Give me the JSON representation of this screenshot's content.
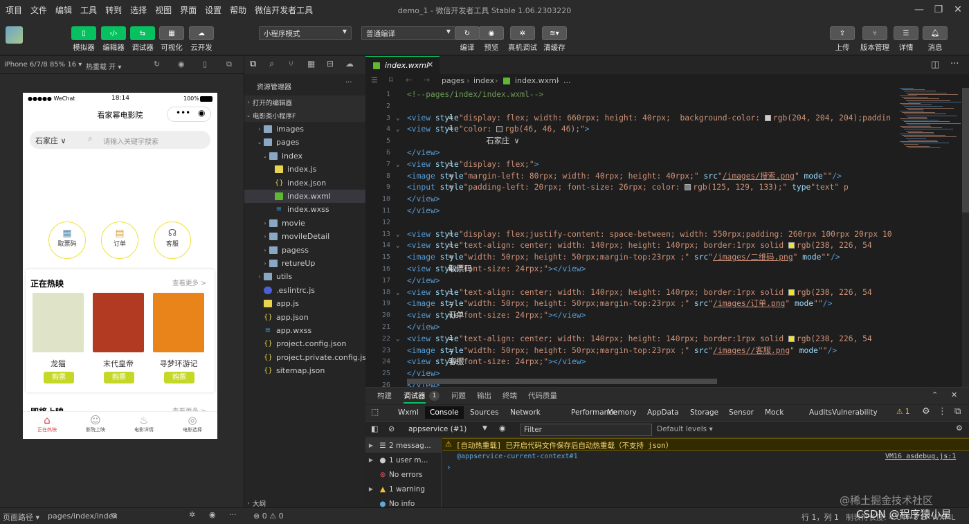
{
  "menu": [
    "项目",
    "文件",
    "编辑",
    "工具",
    "转到",
    "选择",
    "视图",
    "界面",
    "设置",
    "帮助",
    "微信开发者工具"
  ],
  "window_title": "demo_1 - 微信开发者工具 Stable 1.06.2303220",
  "toolbar": {
    "simulator": "模拟器",
    "editor": "编辑器",
    "debugger": "调试器",
    "visual": "可视化",
    "cloud": "云开发",
    "mode_select": "小程序模式",
    "compile_select": "普通编译",
    "compile": "编译",
    "preview": "预览",
    "real_debug": "真机调试",
    "clear_cache": "清缓存",
    "upload": "上传",
    "version": "版本管理",
    "details": "详情",
    "messages": "消息"
  },
  "simulator": {
    "device": "iPhone 6/7/8 85% 16 ▾",
    "hot_reload": "热重载 开 ▾"
  },
  "phone": {
    "status_left": "●●●●● WeChat",
    "time": "18:14",
    "battery": "100%",
    "nav_title": "看家幂电影院",
    "city": "石家庄 ∨",
    "search_placeholder": "请输入关键字搜索",
    "icons": [
      "取票码",
      "订单",
      "客服"
    ],
    "now_showing": "正在热映",
    "see_more": "查看更多 >",
    "movies": [
      {
        "title": "龙猫",
        "buy": "购票",
        "color": "#dfe3c8"
      },
      {
        "title": "末代皇帝",
        "buy": "购票",
        "color": "#b33a22"
      },
      {
        "title": "寻梦环游记",
        "buy": "购票",
        "color": "#e8841a"
      }
    ],
    "coming": "即将上映",
    "coming_more": "查看更多 >",
    "tabs": [
      "正在热映",
      "影院上映",
      "电影详情",
      "电影选择"
    ]
  },
  "explorer": {
    "title": "资源管理器",
    "more": "···",
    "open_editors": "打开的编辑器",
    "project": "电影类小程序F",
    "outline": "大纲",
    "tree": [
      {
        "label": "images",
        "type": "folder",
        "depth": 1,
        "caret": "›"
      },
      {
        "label": "pages",
        "type": "folder",
        "depth": 1,
        "caret": "⌄"
      },
      {
        "label": "index",
        "type": "folder",
        "depth": 2,
        "caret": "⌄"
      },
      {
        "label": "index.js",
        "type": "js",
        "depth": 3,
        "caret": ""
      },
      {
        "label": "index.json",
        "type": "json",
        "depth": 3,
        "caret": ""
      },
      {
        "label": "index.wxml",
        "type": "wxml",
        "depth": 3,
        "caret": "",
        "selected": true
      },
      {
        "label": "index.wxss",
        "type": "wxss",
        "depth": 3,
        "caret": ""
      },
      {
        "label": "movie",
        "type": "folder",
        "depth": 2,
        "caret": "›"
      },
      {
        "label": "movileDetail",
        "type": "folder",
        "depth": 2,
        "caret": "›"
      },
      {
        "label": "pagess",
        "type": "folder",
        "depth": 2,
        "caret": "›"
      },
      {
        "label": "retureUp",
        "type": "folder",
        "depth": 2,
        "caret": "›"
      },
      {
        "label": "utils",
        "type": "folder",
        "depth": 1,
        "caret": "›"
      },
      {
        "label": ".eslintrc.js",
        "type": "eslint",
        "depth": 1,
        "caret": ""
      },
      {
        "label": "app.js",
        "type": "js",
        "depth": 1,
        "caret": ""
      },
      {
        "label": "app.json",
        "type": "json",
        "depth": 1,
        "caret": ""
      },
      {
        "label": "app.wxss",
        "type": "wxss",
        "depth": 1,
        "caret": ""
      },
      {
        "label": "project.config.json",
        "type": "json",
        "depth": 1,
        "caret": ""
      },
      {
        "label": "project.private.config.js...",
        "type": "json",
        "depth": 1,
        "caret": ""
      },
      {
        "label": "sitemap.json",
        "type": "json",
        "depth": 1,
        "caret": ""
      }
    ]
  },
  "editor": {
    "tab": "index.wxml",
    "breadcrumb": [
      "pages",
      "index",
      "index.wxml",
      "..."
    ],
    "lines": [
      {
        "n": "1",
        "f": "",
        "t": [
          [
            "cm",
            "<!--pages/index/index.wxml-->"
          ]
        ]
      },
      {
        "n": "2",
        "f": "",
        "t": []
      },
      {
        "n": "3",
        "f": "⌄",
        "t": [
          [
            "tg",
            "<view "
          ],
          [
            "at",
            "style"
          ],
          [
            "tx",
            "="
          ],
          [
            "sv",
            "\"display: flex; width: 660rpx; height: 40rpx;  background-color: "
          ],
          [
            "sw",
            "#cccccc"
          ],
          [
            "sv",
            "rgb(204, 204, 204);paddin"
          ]
        ]
      },
      {
        "n": "4",
        "f": "⌄",
        "t": [
          [
            "tx",
            "    "
          ],
          [
            "tg",
            "<view "
          ],
          [
            "at",
            "style"
          ],
          [
            "tx",
            "="
          ],
          [
            "sv",
            "\"color: "
          ],
          [
            "sw",
            "#2e2e2e"
          ],
          [
            "sv",
            "rgb(46, 46, 46);\""
          ],
          [
            "tg",
            ">"
          ]
        ]
      },
      {
        "n": "5",
        "f": "",
        "t": [
          [
            "tx",
            "        石家庄 ∨"
          ]
        ]
      },
      {
        "n": "6",
        "f": "",
        "t": [
          [
            "tx",
            "    "
          ],
          [
            "tg",
            "</view>"
          ]
        ]
      },
      {
        "n": "7",
        "f": "⌄",
        "t": [
          [
            "tx",
            "    "
          ],
          [
            "tg",
            "<view "
          ],
          [
            "at",
            "style"
          ],
          [
            "tx",
            "="
          ],
          [
            "sv",
            "\"display: flex;\""
          ],
          [
            "tg",
            ">"
          ]
        ]
      },
      {
        "n": "8",
        "f": "",
        "t": [
          [
            "tx",
            "        "
          ],
          [
            "tg",
            "<image "
          ],
          [
            "at",
            "style"
          ],
          [
            "tx",
            "="
          ],
          [
            "sv",
            "\"margin-left: 80rpx; width: 40rpx; height: 40rpx;\" "
          ],
          [
            "at",
            "src"
          ],
          [
            "tx",
            "="
          ],
          [
            "sv",
            "\""
          ],
          [
            "lk",
            "/images/搜索.png"
          ],
          [
            "sv",
            "\" "
          ],
          [
            "at",
            "mode"
          ],
          [
            "tx",
            "="
          ],
          [
            "sv",
            "\"\""
          ],
          [
            "tg",
            "/>"
          ]
        ]
      },
      {
        "n": "9",
        "f": "",
        "t": [
          [
            "tx",
            "        "
          ],
          [
            "tg",
            "<input "
          ],
          [
            "at",
            "style"
          ],
          [
            "tx",
            "="
          ],
          [
            "sv",
            "\"padding-left: 20rpx; font-size: 26rpx; color: "
          ],
          [
            "sw",
            "#7d8185"
          ],
          [
            "sv",
            "rgb(125, 129, 133);\" "
          ],
          [
            "at",
            "type"
          ],
          [
            "tx",
            "="
          ],
          [
            "sv",
            "\"text\" p"
          ]
        ]
      },
      {
        "n": "10",
        "f": "",
        "t": [
          [
            "tx",
            "    "
          ],
          [
            "tg",
            "</view>"
          ]
        ]
      },
      {
        "n": "11",
        "f": "",
        "t": [
          [
            "tg",
            "</view>"
          ]
        ]
      },
      {
        "n": "12",
        "f": "",
        "t": []
      },
      {
        "n": "13",
        "f": "⌄",
        "t": [
          [
            "tg",
            "<view "
          ],
          [
            "at",
            "style"
          ],
          [
            "tx",
            "="
          ],
          [
            "sv",
            "\"display: flex;justify-content: space-between; width: 550rpx;padding: 260rpx 100rpx 20rpx 10"
          ]
        ]
      },
      {
        "n": "14",
        "f": "⌄",
        "t": [
          [
            "tx",
            "    "
          ],
          [
            "tg",
            "<view "
          ],
          [
            "at",
            "style"
          ],
          [
            "tx",
            "="
          ],
          [
            "sv",
            "\"text-align: center; width: 140rpx; height: 140rpx; border:1rpx solid "
          ],
          [
            "sw",
            "#eee236"
          ],
          [
            "sv",
            "rgb(238, 226, 54"
          ]
        ]
      },
      {
        "n": "15",
        "f": "",
        "t": [
          [
            "tx",
            "        "
          ],
          [
            "tg",
            "<image "
          ],
          [
            "at",
            "style"
          ],
          [
            "tx",
            "="
          ],
          [
            "sv",
            "\"width: 50rpx; height: 50rpx;margin-top:23rpx ;\" "
          ],
          [
            "at",
            "src"
          ],
          [
            "tx",
            "="
          ],
          [
            "sv",
            "\""
          ],
          [
            "lk",
            "/images/二维码.png"
          ],
          [
            "sv",
            "\" "
          ],
          [
            "at",
            "mode"
          ],
          [
            "tx",
            "="
          ],
          [
            "sv",
            "\"\""
          ],
          [
            "tg",
            "/>"
          ]
        ]
      },
      {
        "n": "16",
        "f": "",
        "t": [
          [
            "tx",
            "        "
          ],
          [
            "tg",
            "<view "
          ],
          [
            "at",
            "style"
          ],
          [
            "tx",
            "="
          ],
          [
            "sv",
            "\"font-size: 24rpx;\""
          ],
          [
            "tg",
            ">"
          ],
          [
            "tx",
            "取票码"
          ],
          [
            "tg",
            "</view>"
          ]
        ]
      },
      {
        "n": "17",
        "f": "",
        "t": [
          [
            "tx",
            "    "
          ],
          [
            "tg",
            "</view>"
          ]
        ]
      },
      {
        "n": "18",
        "f": "⌄",
        "t": [
          [
            "tx",
            "    "
          ],
          [
            "tg",
            "<view "
          ],
          [
            "at",
            "style"
          ],
          [
            "tx",
            "="
          ],
          [
            "sv",
            "\"text-align: center; width: 140rpx; height: 140rpx; border:1rpx solid "
          ],
          [
            "sw",
            "#eee236"
          ],
          [
            "sv",
            "rgb(238, 226, 54"
          ]
        ]
      },
      {
        "n": "19",
        "f": "",
        "t": [
          [
            "tx",
            "        "
          ],
          [
            "tg",
            "<image "
          ],
          [
            "at",
            "style"
          ],
          [
            "tx",
            "="
          ],
          [
            "sv",
            "\"width: 50rpx; height: 50rpx;margin-top:23rpx ;\" "
          ],
          [
            "at",
            "src"
          ],
          [
            "tx",
            "="
          ],
          [
            "sv",
            "\""
          ],
          [
            "lk",
            "/images/订单.png"
          ],
          [
            "sv",
            "\" "
          ],
          [
            "at",
            "mode"
          ],
          [
            "tx",
            "="
          ],
          [
            "sv",
            "\"\""
          ],
          [
            "tg",
            "/>"
          ]
        ]
      },
      {
        "n": "20",
        "f": "",
        "t": [
          [
            "tx",
            "        "
          ],
          [
            "tg",
            "<view "
          ],
          [
            "at",
            "style"
          ],
          [
            "tx",
            "="
          ],
          [
            "sv",
            "\"font-size: 24rpx;\""
          ],
          [
            "tg",
            ">"
          ],
          [
            "tx",
            "订单"
          ],
          [
            "tg",
            "</view>"
          ]
        ]
      },
      {
        "n": "21",
        "f": "",
        "t": [
          [
            "tx",
            "    "
          ],
          [
            "tg",
            "</view>"
          ]
        ]
      },
      {
        "n": "22",
        "f": "⌄",
        "t": [
          [
            "tx",
            "    "
          ],
          [
            "tg",
            "<view "
          ],
          [
            "at",
            "style"
          ],
          [
            "tx",
            "="
          ],
          [
            "sv",
            "\"text-align: center; width: 140rpx; height: 140rpx; border:1rpx solid "
          ],
          [
            "sw",
            "#eee236"
          ],
          [
            "sv",
            "rgb(238, 226, 54"
          ]
        ]
      },
      {
        "n": "23",
        "f": "",
        "t": [
          [
            "tx",
            "        "
          ],
          [
            "tg",
            "<image "
          ],
          [
            "at",
            "style"
          ],
          [
            "tx",
            "="
          ],
          [
            "sv",
            "\"width: 50rpx; height: 50rpx;margin-top:23rpx ;\" "
          ],
          [
            "at",
            "src"
          ],
          [
            "tx",
            "="
          ],
          [
            "sv",
            "\""
          ],
          [
            "lk",
            "/images//客服.png"
          ],
          [
            "sv",
            "\" "
          ],
          [
            "at",
            "mode"
          ],
          [
            "tx",
            "="
          ],
          [
            "sv",
            "\"\""
          ],
          [
            "tg",
            "/>"
          ]
        ]
      },
      {
        "n": "24",
        "f": "",
        "t": [
          [
            "tx",
            "        "
          ],
          [
            "tg",
            "<view "
          ],
          [
            "at",
            "style"
          ],
          [
            "tx",
            "="
          ],
          [
            "sv",
            "\"font-size: 24rpx;\""
          ],
          [
            "tg",
            ">"
          ],
          [
            "tx",
            "客服"
          ],
          [
            "tg",
            "</view>"
          ]
        ]
      },
      {
        "n": "25",
        "f": "",
        "t": [
          [
            "tx",
            "    "
          ],
          [
            "tg",
            "</view>"
          ]
        ]
      },
      {
        "n": "26",
        "f": "",
        "t": [
          [
            "tg",
            "</view>"
          ]
        ]
      }
    ]
  },
  "debug": {
    "tabs": [
      "构建",
      "调试器",
      "问题",
      "输出",
      "终端",
      "代码质量"
    ],
    "badge": "1",
    "panels": [
      "Wxml",
      "Console",
      "Sources",
      "Network",
      "Performance",
      "Memory",
      "AppData",
      "Storage",
      "Sensor",
      "Mock",
      "Audits",
      "Vulnerability"
    ],
    "warn_count": "⚠ 1",
    "context": "appservice (#1)",
    "filter_placeholder": "Filter",
    "levels": "Default levels ▾",
    "sidebar": [
      {
        "label": "2 messag...",
        "icon": "list"
      },
      {
        "label": "1 user m...",
        "icon": "user"
      },
      {
        "label": "No errors",
        "icon": "error"
      },
      {
        "label": "1 warning",
        "icon": "warn"
      },
      {
        "label": "No info",
        "icon": "info"
      }
    ],
    "warning_text": "[自动热重载] 已开启代码文件保存后自动热重载（不支持 json）",
    "context_link": "@appservice-current-context#1",
    "source_link": "VM16 asdebug.js:1",
    "prompt": "›"
  },
  "status": {
    "page_path_label": "页面路径 ▾",
    "page_path": "pages/index/index",
    "errors": "⊗ 0 ⚠ 0",
    "cursor": "行 1，列 1",
    "encoding": "制表符长度: 4   UTF-8   LF   WXML",
    "watermark": "CSDN @程序猿小星",
    "watermark2": "@稀土掘金技术社区"
  }
}
